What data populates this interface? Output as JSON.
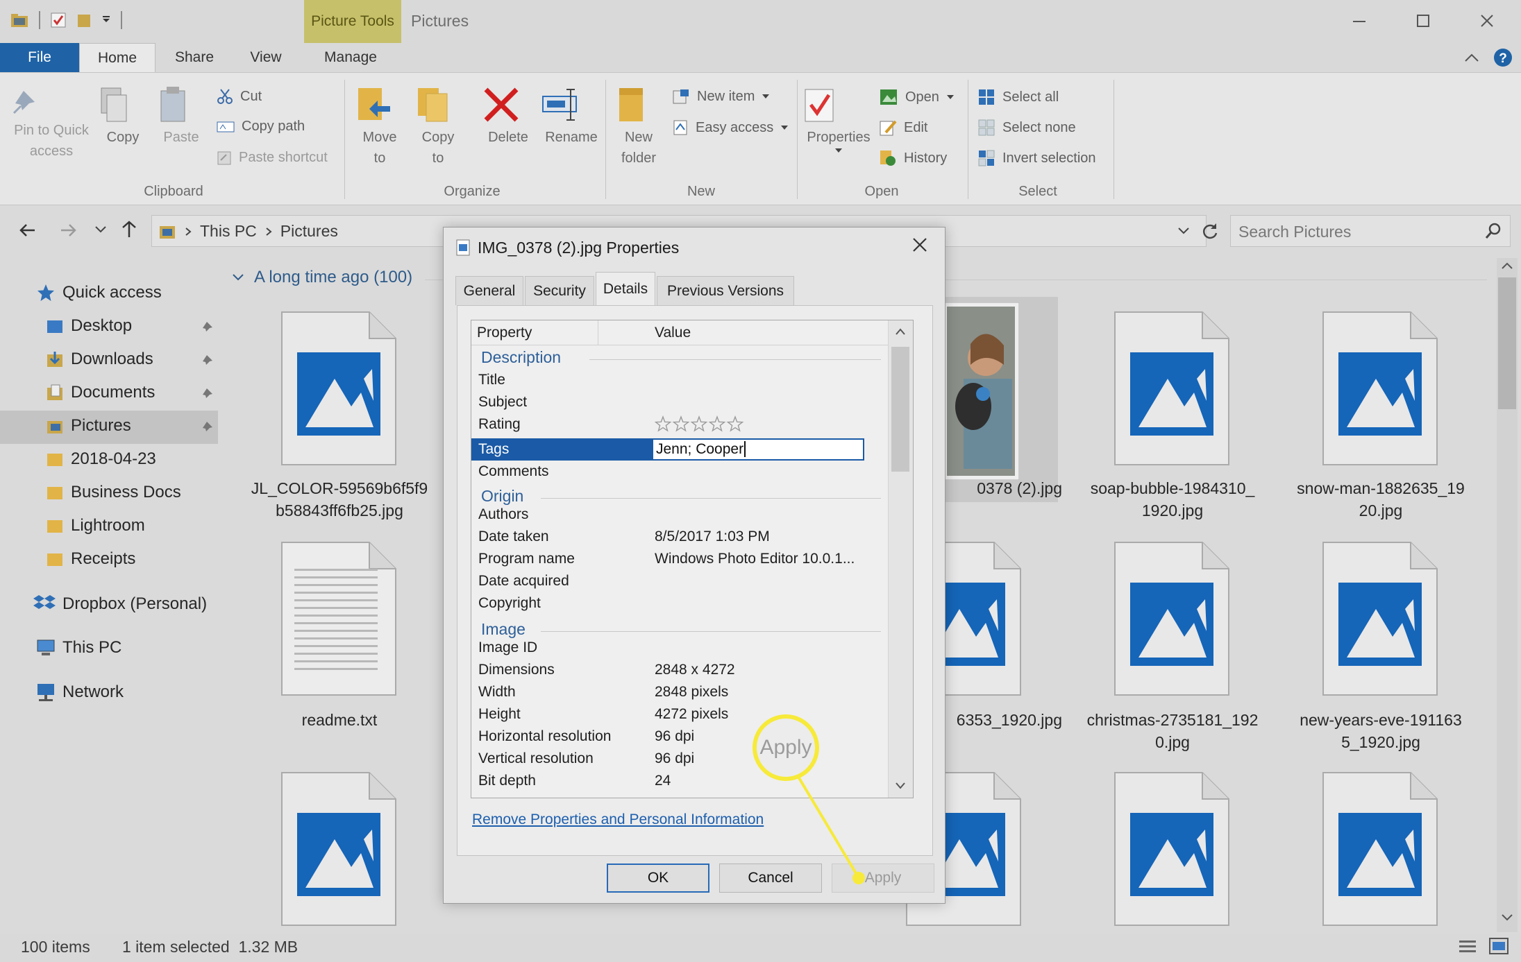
{
  "window": {
    "contextual_tab": "Picture Tools",
    "title": "Pictures"
  },
  "ribbon": {
    "tabs": [
      "File",
      "Home",
      "Share",
      "View",
      "Manage"
    ],
    "clipboard": {
      "pin": "Pin to Quick",
      "pin2": "access",
      "copy": "Copy",
      "paste": "Paste",
      "cut": "Cut",
      "copy_path": "Copy path",
      "paste_shortcut": "Paste shortcut",
      "label": "Clipboard"
    },
    "organize": {
      "move": "Move",
      "move2": "to",
      "copy": "Copy",
      "copy2": "to",
      "delete": "Delete",
      "rename": "Rename",
      "label": "Organize"
    },
    "new": {
      "folder": "New",
      "folder2": "folder",
      "new_item": "New item",
      "easy_access": "Easy access",
      "label": "New"
    },
    "open": {
      "properties": "Properties",
      "open": "Open",
      "edit": "Edit",
      "history": "History",
      "label": "Open"
    },
    "select": {
      "select_all": "Select all",
      "select_none": "Select none",
      "invert": "Invert selection",
      "label": "Select"
    }
  },
  "address": {
    "crumbs": [
      "This PC",
      "Pictures"
    ],
    "search_placeholder": "Search Pictures"
  },
  "nav": {
    "quick_access": "Quick access",
    "items": [
      "Desktop",
      "Downloads",
      "Documents",
      "Pictures",
      "2018-04-23",
      "Business Docs",
      "Lightroom",
      "Receipts"
    ],
    "dropbox": "Dropbox (Personal)",
    "this_pc": "This PC",
    "network": "Network"
  },
  "content": {
    "group_header": "A long time ago (100)",
    "files": [
      {
        "line1": "JL_COLOR-59569b6f5f9",
        "line2": "b58843ff6fb25.jpg"
      },
      {
        "line1": "0378 (2).jpg",
        "line2": ""
      },
      {
        "line1": "soap-bubble-1984310_",
        "line2": "1920.jpg"
      },
      {
        "line1": "snow-man-1882635_19",
        "line2": "20.jpg"
      },
      {
        "line1": "readme.txt",
        "line2": ""
      },
      {
        "line1": "6353_1920.jpg",
        "line2": ""
      },
      {
        "line1": "christmas-2735181_192",
        "line2": "0.jpg"
      },
      {
        "line1": "new-years-eve-191163",
        "line2": "5_1920.jpg"
      }
    ]
  },
  "status": {
    "count": "100 items",
    "selected": "1 item selected  1.32 MB"
  },
  "dialog": {
    "title": "IMG_0378 (2).jpg Properties",
    "tabs": [
      "General",
      "Security",
      "Details",
      "Previous Versions"
    ],
    "columns": {
      "property": "Property",
      "value": "Value"
    },
    "sections": {
      "description": "Description",
      "origin": "Origin",
      "image": "Image"
    },
    "rows": {
      "title": {
        "p": "Title",
        "v": ""
      },
      "subject": {
        "p": "Subject",
        "v": ""
      },
      "rating": {
        "p": "Rating",
        "stars": 0,
        "max": 5
      },
      "tags": {
        "p": "Tags",
        "v": "Jenn; Cooper"
      },
      "comments": {
        "p": "Comments",
        "v": ""
      },
      "authors": {
        "p": "Authors",
        "v": ""
      },
      "date_taken": {
        "p": "Date taken",
        "v": "8/5/2017 1:03 PM"
      },
      "program": {
        "p": "Program name",
        "v": "Windows Photo Editor 10.0.1..."
      },
      "date_acquired": {
        "p": "Date acquired",
        "v": ""
      },
      "copyright": {
        "p": "Copyright",
        "v": ""
      },
      "image_id": {
        "p": "Image ID",
        "v": ""
      },
      "dimensions": {
        "p": "Dimensions",
        "v": "2848 x 4272"
      },
      "width": {
        "p": "Width",
        "v": "2848 pixels"
      },
      "height": {
        "p": "Height",
        "v": "4272 pixels"
      },
      "hres": {
        "p": "Horizontal resolution",
        "v": "96 dpi"
      },
      "vres": {
        "p": "Vertical resolution",
        "v": "96 dpi"
      },
      "bitdepth": {
        "p": "Bit depth",
        "v": "24"
      }
    },
    "remove_link": "Remove Properties and Personal Information",
    "ok": "OK",
    "cancel": "Cancel",
    "apply": "Apply"
  },
  "callout": {
    "label": "Apply",
    "color": "#f7ea3a"
  },
  "colors": {
    "accent": "#1f63a6",
    "selection": "#1a5aa6",
    "link": "#1d5fae",
    "picture_icon": "#1565b8"
  }
}
